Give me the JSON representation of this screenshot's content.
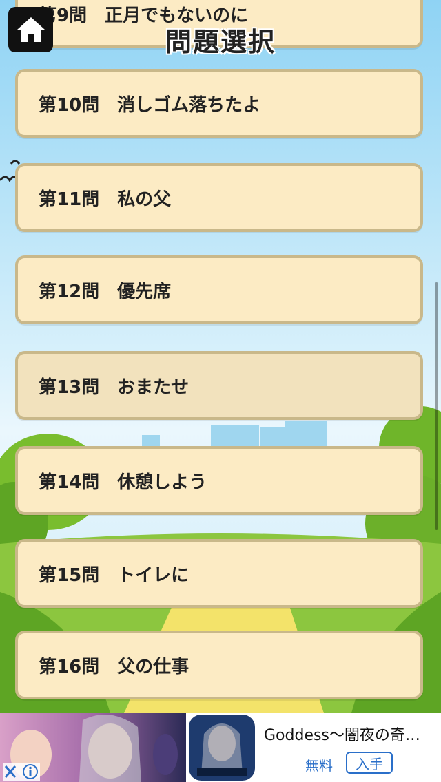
{
  "header": {
    "title": "問題選択",
    "home_icon": "home-icon"
  },
  "questions": [
    {
      "label": "第9問　正月でもないのに"
    },
    {
      "label": "第10問　消しゴム落ちたよ"
    },
    {
      "label": "第11問　私の父"
    },
    {
      "label": "第12問　優先席"
    },
    {
      "label": "第13問　おまたせ"
    },
    {
      "label": "第14問　休憩しよう"
    },
    {
      "label": "第15問　トイレに"
    },
    {
      "label": "第16問　父の仕事"
    }
  ],
  "ad": {
    "title": "Goddess〜闇夜の奇…",
    "free_label": "無料",
    "install_label": "入手",
    "close_icon": "close-icon",
    "info_icon": "info-icon"
  },
  "colors": {
    "card_bg": "#fcebc4",
    "card_border": "#c9b88a",
    "sky": "#aee3f7",
    "grass": "#8cc63f",
    "ad_blue": "#2a6fc9"
  }
}
